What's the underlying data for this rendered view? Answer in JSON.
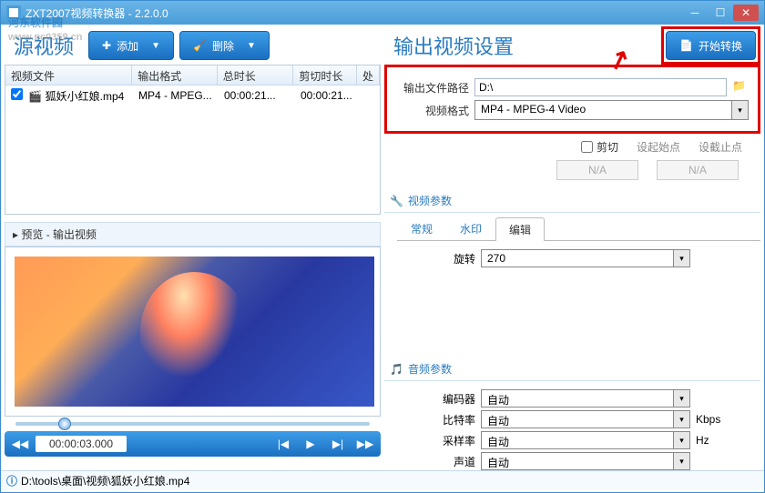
{
  "titlebar": {
    "title": "ZXT2007视频转换器 - 2.2.0.0"
  },
  "watermark": {
    "main": "河东软件园",
    "sub": "www.pc0359.cn"
  },
  "left": {
    "title": "源视频",
    "add_label": "添加",
    "delete_label": "删除",
    "cols": {
      "file": "视频文件",
      "format": "输出格式",
      "duration": "总时长",
      "clip": "剪切时长",
      "proc": "处"
    },
    "rows": [
      {
        "file": "狐妖小红娘.mp4",
        "format": "MP4 - MPEG...",
        "duration": "00:00:21...",
        "clip": "00:00:21..."
      }
    ],
    "preview_label": "▸ 预览 - 输出视频",
    "time_display": "00:00:03.000"
  },
  "right": {
    "title": "输出视频设置",
    "start_label": "开始转换",
    "out_path_label": "输出文件路径",
    "out_path_value": "D:\\",
    "format_label": "视频格式",
    "format_value": "MP4 - MPEG-4 Video",
    "clip_chk": "剪切",
    "set_start": "设起始点",
    "set_end": "设截止点",
    "na": "N/A",
    "video_params": "视频参数",
    "tabs": {
      "general": "常规",
      "watermark": "水印",
      "edit": "编辑"
    },
    "rotate_label": "旋转",
    "rotate_value": "270",
    "audio_params": "音频参数",
    "encoder_label": "编码器",
    "bitrate_label": "比特率",
    "samplerate_label": "采样率",
    "channel_label": "声道",
    "auto": "自动",
    "kbps": "Kbps",
    "hz": "Hz"
  },
  "statusbar": {
    "path": "D:\\tools\\桌面\\视频\\狐妖小红娘.mp4"
  }
}
